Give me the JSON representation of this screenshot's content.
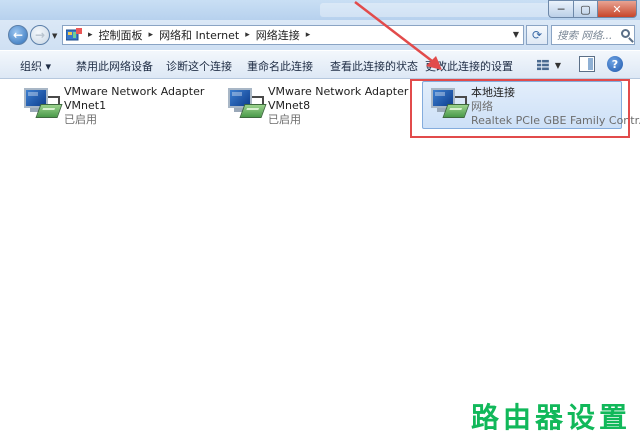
{
  "titlebar": {
    "minimize_glyph": "─",
    "maximize_glyph": "▢",
    "close_glyph": "✕"
  },
  "address": {
    "breadcrumbs": [
      "控制面板",
      "网络和 Internet",
      "网络连接"
    ],
    "separator": "▸",
    "search_placeholder": "搜索 网络..."
  },
  "toolbar": {
    "organize": "组织 ▾",
    "disable_device": "禁用此网络设备",
    "diagnose": "诊断这个连接",
    "rename": "重命名此连接",
    "view_status": "查看此连接的状态",
    "change_settings": "更改此连接的设置",
    "help_glyph": "?"
  },
  "adapters": [
    {
      "line1": "VMware Network Adapter",
      "line2": "VMnet1",
      "line3": "已启用"
    },
    {
      "line1": "VMware Network Adapter",
      "line2": "VMnet8",
      "line3": "已启用"
    },
    {
      "line1": "本地连接",
      "line2": "网络",
      "line3": "Realtek PCIe GBE Family Contr..."
    }
  ],
  "watermark": "路由器设置",
  "colors": {
    "highlight": "#e24b4b",
    "watermark": "#11b85a",
    "selection": "#cde0f7"
  }
}
